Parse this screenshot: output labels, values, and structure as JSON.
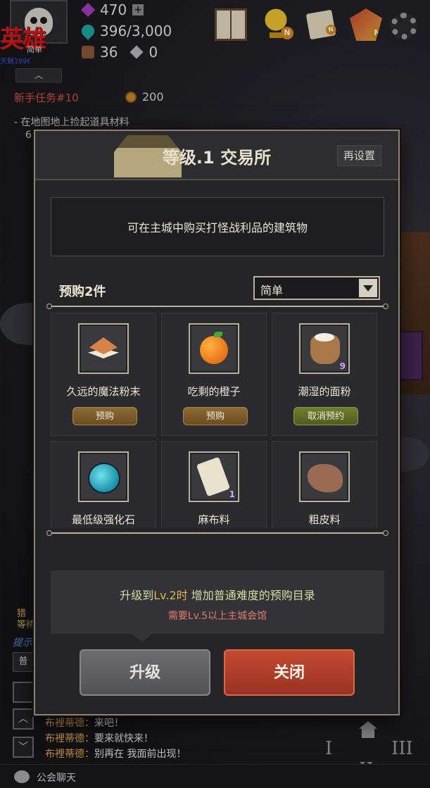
{
  "hud": {
    "hero_badge": "英雄",
    "avatar_name": "简单",
    "avatar_sub": "天魅199€",
    "gems": "470",
    "gems_plus": "+",
    "crystals": "396/3,000",
    "chests": "36",
    "cubes": "0",
    "collapse": "︿",
    "notify_badges": [
      "N",
      "N",
      "N"
    ]
  },
  "quest": {
    "title": "新手任务#10",
    "reward": "200",
    "item": "-  在地图地上捡起道具材料",
    "progress": "6"
  },
  "dialog": {
    "title": "等级.1 交易所",
    "reset_label": "再设置",
    "description": "可在主城中购买打怪战利品的建筑物",
    "preorder_label": "预购2件",
    "difficulty_selected": "简单",
    "items": [
      {
        "name": "久远的魔法粉末",
        "button": "预购",
        "icon": "magic-powder-icon",
        "count": ""
      },
      {
        "name": "吃剩的橙子",
        "button": "预购",
        "icon": "orange-icon",
        "count": ""
      },
      {
        "name": "潮湿的面粉",
        "button": "取消预约",
        "icon": "flour-sack-icon",
        "count": "9"
      },
      {
        "name": "最低级强化石",
        "button": "",
        "icon": "enhance-stone-icon",
        "count": ""
      },
      {
        "name": "麻布料",
        "button": "",
        "icon": "linen-cloth-icon",
        "count": "1"
      },
      {
        "name": "粗皮料",
        "button": "",
        "icon": "rough-hide-icon",
        "count": ""
      }
    ],
    "upgrade_prefix": "升级到",
    "upgrade_level": "Lv.2时",
    "upgrade_suffix": " 增加普通难度的预购目录",
    "upgrade_requirement": "需要Lv.5以上主城会馆",
    "upgrade_button": "升级",
    "close_button": "关闭"
  },
  "chat": {
    "lines": [
      {
        "who": "布裡蒂德：",
        "msg": "来吧！"
      },
      {
        "who": "布裡蒂德：",
        "msg": "要来就快来！"
      },
      {
        "who": "布裡蒂德：",
        "msg": "别再在 我面前出现！"
      }
    ],
    "bar_label": "公会聊天",
    "side_texts": [
      "猎",
      "等待",
      "提示",
      "普"
    ]
  },
  "nav": {
    "numerals": [
      "I",
      "II",
      "III"
    ]
  },
  "colors": {
    "accent_close": "#c44a32",
    "accent_preorder": "#8d6a34",
    "accent_cancel": "#6d7f2f",
    "quest_title": "#d6503c"
  }
}
